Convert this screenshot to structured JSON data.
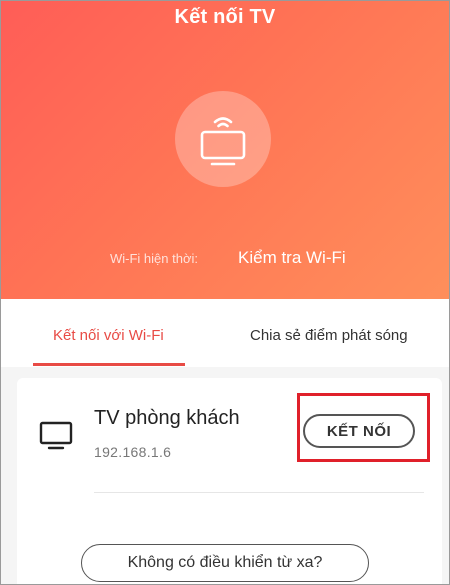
{
  "header": {
    "title": "Kết nối TV",
    "wifi_label": "Wi-Fi hiện thời:",
    "wifi_check": "Kiểm tra Wi-Fi",
    "tv_icon": "tv-cast-icon",
    "gradient_colors": [
      "#ff5d57",
      "#ff8f5b"
    ]
  },
  "tabs": {
    "items": [
      {
        "label": "Kết nối với Wi-Fi",
        "active": true
      },
      {
        "label": "Chia sẻ điểm phát sóng",
        "active": false
      }
    ],
    "accent_color": "#e84b45"
  },
  "device": {
    "icon": "monitor-icon",
    "name": "TV phòng khách",
    "ip": "192.168.1.6",
    "connect_label": "KẾT NỐI"
  },
  "no_remote_label": "Không có điều khiển từ xa?",
  "highlight_color": "#e0202a"
}
